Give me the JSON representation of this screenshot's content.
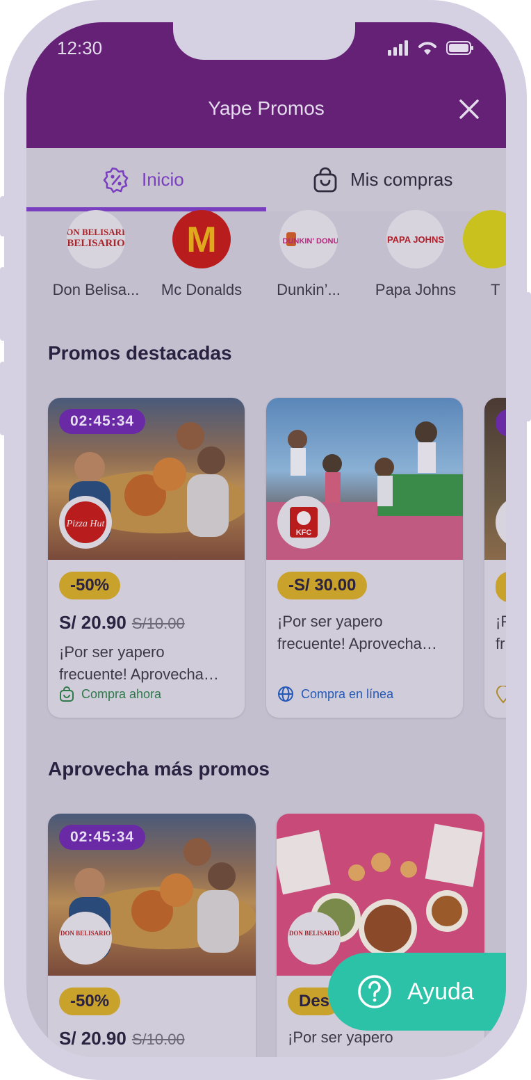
{
  "status_bar": {
    "time": "12:30"
  },
  "header": {
    "title": "Yape Promos"
  },
  "tabs": [
    {
      "label": "Inicio",
      "icon": "percent-badge-icon",
      "active": true
    },
    {
      "label": "Mis compras",
      "icon": "shopping-bag-icon",
      "active": false
    }
  ],
  "brands": [
    {
      "name": "Don Belisa...",
      "logo_text": "DON BELISARIO"
    },
    {
      "name": "Mc Donalds",
      "logo_text": "M"
    },
    {
      "name": "Dunkin’...",
      "logo_text": "DUNKIN' DONUTS"
    },
    {
      "name": "Papa Johns",
      "logo_text": "PAPA JOHNS"
    },
    {
      "name": "T",
      "logo_text": ""
    }
  ],
  "featured": {
    "title": "Promos destacadas",
    "cards": [
      {
        "timer": "02:45:34",
        "brand_logo": "Pizza Hut",
        "badge": "-50%",
        "price": "S/ 20.90",
        "old_price": "S/10.00",
        "desc": "¡Por ser yapero frecuente! Aprovecha…",
        "action": "Compra ahora",
        "action_icon": "shopping-bag-icon"
      },
      {
        "timer": "",
        "brand_logo": "KFC",
        "badge": "-S/ 30.00",
        "price": "",
        "old_price": "",
        "desc": "¡Por ser yapero frecuente! Aprovecha…",
        "action": "Compra en línea",
        "action_icon": "globe-icon"
      },
      {
        "timer": "",
        "brand_logo": "",
        "badge": "",
        "price": "",
        "old_price": "",
        "desc": "¡P fr",
        "action": "",
        "action_icon": "location-pin-icon"
      }
    ]
  },
  "more": {
    "title": "Aprovecha más promos",
    "cards": [
      {
        "timer": "02:45:34",
        "brand_logo": "DON BELISARIO",
        "badge": "-50%",
        "price": "S/ 20.90",
        "old_price": "S/10.00",
        "desc": ""
      },
      {
        "timer": "",
        "brand_logo": "DON BELISARIO",
        "badge": "Des",
        "price": "",
        "old_price": "",
        "desc": "¡Por ser yapero"
      }
    ]
  },
  "help_button": {
    "label": "Ayuda"
  },
  "colors": {
    "header": "#642176",
    "accent": "#7a3fbf",
    "badge": "#c9a22c",
    "help": "#2cc2a8",
    "action_green": "#2e7a4a",
    "action_blue": "#2458b8"
  }
}
